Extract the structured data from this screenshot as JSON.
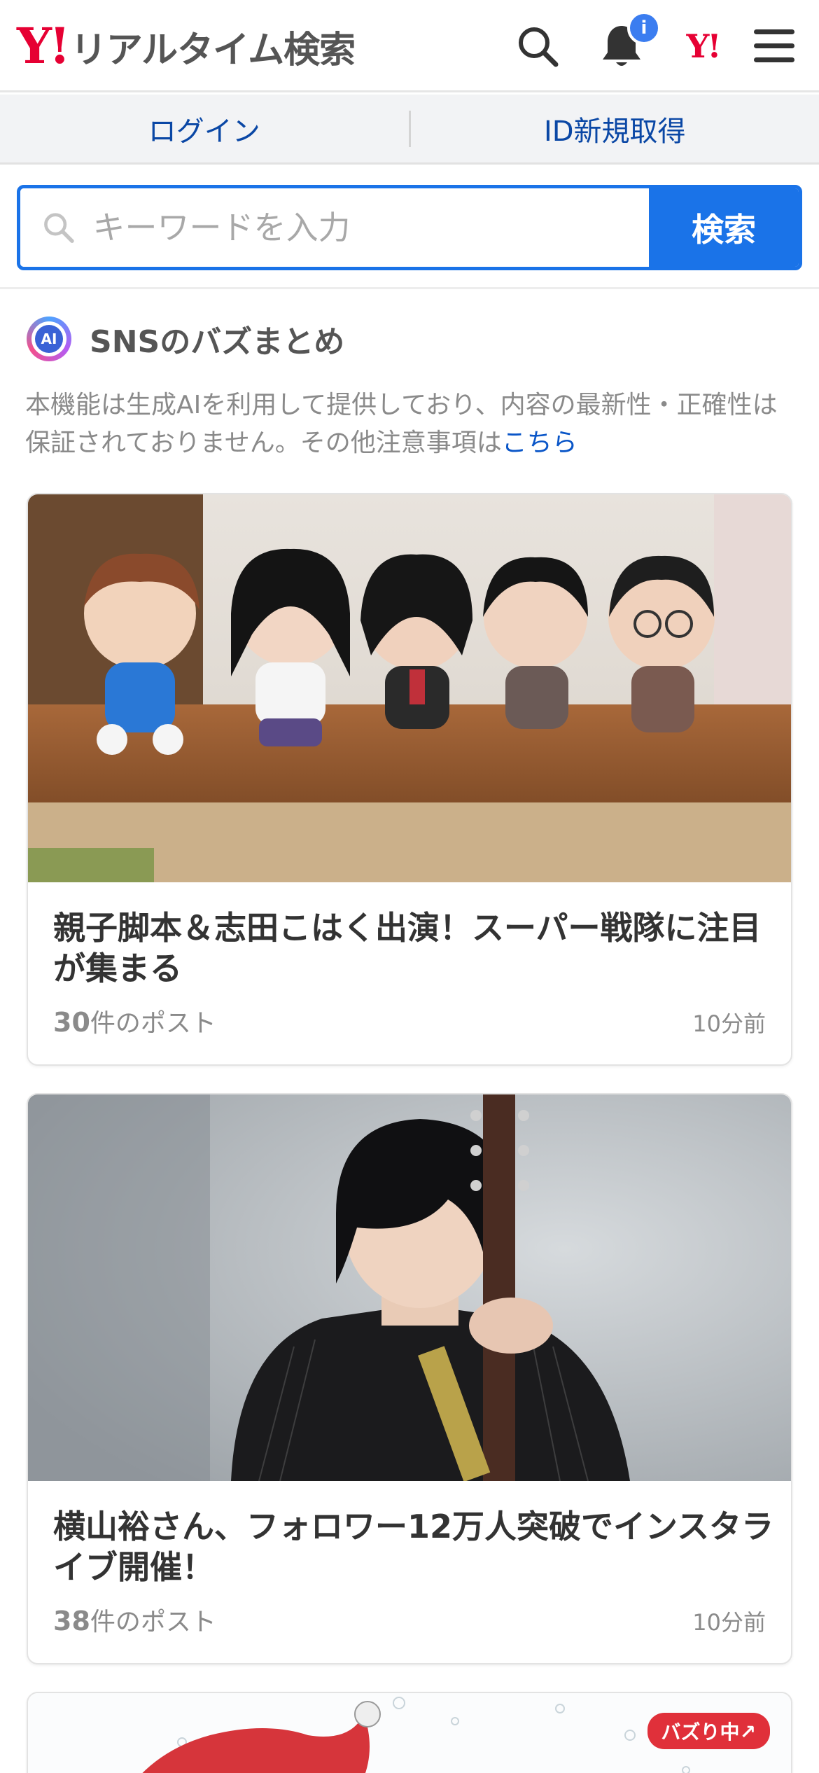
{
  "header": {
    "logo_y": "Y!",
    "logo_title": "リアルタイム検索",
    "notification_badge": "i",
    "yj_mark": "Y!"
  },
  "auth": {
    "login": "ログイン",
    "register": "ID新規取得"
  },
  "search": {
    "placeholder": "キーワードを入力",
    "button": "検索"
  },
  "section": {
    "ai_badge": "AI",
    "title": "SNSのバズまとめ",
    "disclaimer_text": "本機能は生成AIを利用して提供しており、内容の最新性・正確性は保証されておりません。その他注意事項は",
    "disclaimer_link": "こちら"
  },
  "cards": [
    {
      "title": "親子脚本＆志田こはく出演！スーパー戦隊に注目が集まる",
      "count": "30",
      "count_suffix": "件のポスト",
      "time": "10分前"
    },
    {
      "title": "横山裕さん、フォロワー12万人突破でインスタライブ開催！",
      "count": "38",
      "count_suffix": "件のポスト",
      "time": "10分前"
    },
    {
      "badge": "バズり中↗"
    }
  ],
  "colors": {
    "brand_red": "#e60033",
    "accent_blue": "#1a73e8",
    "link_blue": "#0a47a5"
  }
}
